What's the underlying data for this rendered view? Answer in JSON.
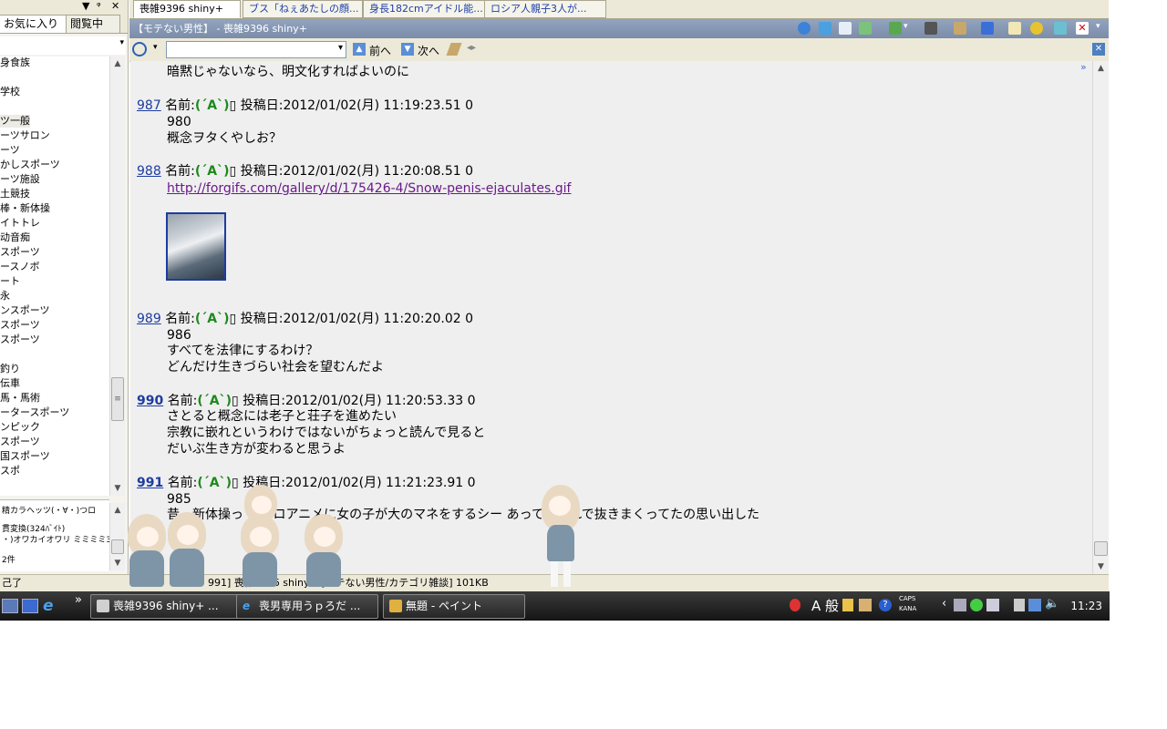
{
  "left_pane": {
    "header_icons": [
      "▼",
      "ᵠ",
      "✕"
    ],
    "tabs": [
      "お気に入り",
      "閲覧中"
    ],
    "categories": [
      "身食族",
      "",
      "学校",
      "",
      "ツ一般",
      "ーツサロン",
      "ーツ",
      "かしスポーツ",
      "ーツ施設",
      "土競技",
      "棒・新体操",
      "イトトレ",
      "动音痴",
      "スポーツ",
      "ースノボ",
      "ート",
      "永",
      "ンスポーツ",
      "スポーツ",
      "スポーツ",
      "",
      "釣り",
      "伝車",
      "馬・馬術",
      "ータースポーツ",
      "ンピック",
      "スポーツ",
      "国スポーツ",
      "スポ"
    ],
    "bottom_lines": [
      "精カラヘッツ(・∀・)つロ",
      "貫変換(324ﾊﾞｲﾄ)",
      "・)オワカイオワリ ミミミミ3",
      "2件"
    ]
  },
  "status_bar": {
    "left": "己了",
    "text": "991] 喪雑9396 shiny+ [モテない男性/カテゴリ雑談]  101KB"
  },
  "doc_tabs": [
    "喪雑9396 shiny+",
    "ブス「ねぇあたしの顔...",
    "身長182cmアイドル能...",
    "ロシア人親子3人が..."
  ],
  "thread_title": "【モテない男性】 - 喪雑9396 shiny+",
  "nav": {
    "search_icon": "search-icon",
    "prev": "前へ",
    "next": "次へ"
  },
  "thread": {
    "top_line": "暗黙じゃないなら、明文化すればよいのに",
    "posts": [
      {
        "num": "987",
        "name_label": "名前:",
        "name": "(´A`)",
        "mark": "▯",
        "date_label": "投稿日:",
        "date": "2012/01/02(月) 11:19:23.51 0",
        "lines": [
          "980",
          "概念ヲタくやしお？"
        ]
      },
      {
        "num": "988",
        "name_label": "名前:",
        "name": "(´A`)",
        "mark": "▯",
        "date_label": "投稿日:",
        "date": "2012/01/02(月) 11:20:08.51 0",
        "link": "http://forgifs.com/gallery/d/175426-4/Snow-penis-ejaculates.gif"
      },
      {
        "num": "989",
        "name_label": "名前:",
        "name": "(´A`)",
        "mark": "▯",
        "date_label": "投稿日:",
        "date": "2012/01/02(月) 11:20:20.02 0",
        "lines": [
          "986",
          "すべてを法律にするわけ？",
          "どんだけ生きづらい社会を望むんだよ"
        ]
      },
      {
        "num": "990",
        "name_label": "名前:",
        "name": "(´A`)",
        "mark": "▯",
        "date_label": "投稿日:",
        "date": "2012/01/02(月) 11:20:53.33 0",
        "lines": [
          "さとると概念には老子と荘子を進めたい",
          "宗教に嵌れというわけではないがちょっと読んで見ると",
          "だいぶ生き方が変わると思うよ"
        ]
      },
      {
        "num": "991",
        "name_label": "名前:",
        "name": "(´A`)",
        "mark": "▯",
        "date_label": "投稿日:",
        "date": "2012/01/02(月) 11:21:23.91 0",
        "lines": [
          "985",
          "昔、新体操っ  のエロアニメに女の子が大のマネをするシー   あって、それで抜きまくってたの思い出した"
        ]
      }
    ]
  },
  "taskbar": {
    "chevron": "»",
    "buttons": [
      "喪雑9396 shiny+ ...",
      "喪男専用うｐろだ ...",
      "無題 - ペイント"
    ],
    "tray_text": "A 般",
    "caps": "CAPS",
    "kana": "KANA",
    "clock": "11:23"
  },
  "colors": {
    "accent": "#1d3ca0",
    "name_green": "#1c8a1c",
    "link_purple": "#6a1a8a",
    "title_bar": "#7a8ca8"
  }
}
